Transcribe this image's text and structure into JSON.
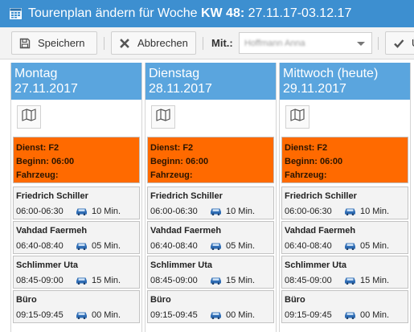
{
  "window": {
    "title_prefix": "Tourenplan ändern für Woche ",
    "week_label": "KW 48:",
    "date_range": " 27.11.17-03.12.17"
  },
  "toolbar": {
    "save_label": "Speichern",
    "cancel_label": "Abbrechen",
    "mit_label": "Mit.:",
    "mit_value": "Hoffmann Anna"
  },
  "days": [
    {
      "name": "Montag",
      "date": "27.11.2017",
      "dienst": {
        "line1": "Dienst: F2",
        "line2": "Beginn: 06:00",
        "line3": "Fahrzeug:"
      },
      "tours": [
        {
          "name": "Friedrich Schiller",
          "time": "06:00-06:30",
          "drive": "10 Min."
        },
        {
          "name": "Vahdad Faermeh",
          "time": "06:40-08:40",
          "drive": "05 Min."
        },
        {
          "name": "Schlimmer Uta",
          "time": "08:45-09:00",
          "drive": "15 Min."
        },
        {
          "name": "Büro",
          "time": "09:15-09:45",
          "drive": "00 Min."
        }
      ]
    },
    {
      "name": "Dienstag",
      "date": "28.11.2017",
      "dienst": {
        "line1": "Dienst: F2",
        "line2": "Beginn: 06:00",
        "line3": "Fahrzeug:"
      },
      "tours": [
        {
          "name": "Friedrich Schiller",
          "time": "06:00-06:30",
          "drive": "10 Min."
        },
        {
          "name": "Vahdad Faermeh",
          "time": "06:40-08:40",
          "drive": "05 Min."
        },
        {
          "name": "Schlimmer Uta",
          "time": "08:45-09:00",
          "drive": "15 Min."
        },
        {
          "name": "Büro",
          "time": "09:15-09:45",
          "drive": "00 Min."
        }
      ]
    },
    {
      "name": "Mittwoch (heute)",
      "date": "29.11.2017",
      "dienst": {
        "line1": "Dienst: F2",
        "line2": "Beginn: 06:00",
        "line3": "Fahrzeug:"
      },
      "tours": [
        {
          "name": "Friedrich Schiller",
          "time": "06:00-06:30",
          "drive": "10 Min."
        },
        {
          "name": "Vahdad Faermeh",
          "time": "06:40-08:40",
          "drive": "05 Min."
        },
        {
          "name": "Schlimmer Uta",
          "time": "08:45-09:00",
          "drive": "15 Min."
        },
        {
          "name": "Büro",
          "time": "09:15-09:45",
          "drive": "00 Min."
        }
      ]
    }
  ],
  "colors": {
    "titlebar": "#3d8fd0",
    "day_header": "#5aa5de",
    "dienst": "#ff6a00",
    "car_icon": "#2f6db5"
  },
  "icons": {
    "app": "calendar-grid-icon",
    "save": "floppy-disk-icon",
    "cancel": "close-x-icon",
    "map": "map-icon",
    "car": "car-icon",
    "confirm": "check-icon"
  }
}
